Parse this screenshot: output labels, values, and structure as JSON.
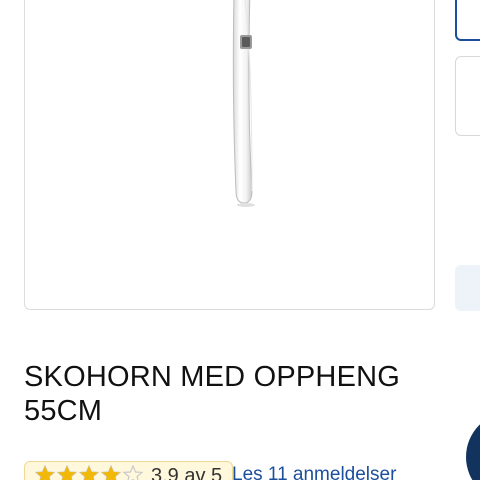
{
  "product": {
    "title": "SKOHORN MED OPPHENG 55CM",
    "image_alt": "Skohorn med oppheng"
  },
  "rating": {
    "value": 3.9,
    "max": 5,
    "text": "3,9 av 5",
    "star_color": "#f2b807",
    "empty_star_color": "#c9c9c9"
  },
  "reviews": {
    "link_text": "Les 11 anmeldelser"
  },
  "colors": {
    "accent": "#1b4f9c",
    "chat_button": "#13335f"
  },
  "icons": {
    "chat": "chat-icon"
  }
}
